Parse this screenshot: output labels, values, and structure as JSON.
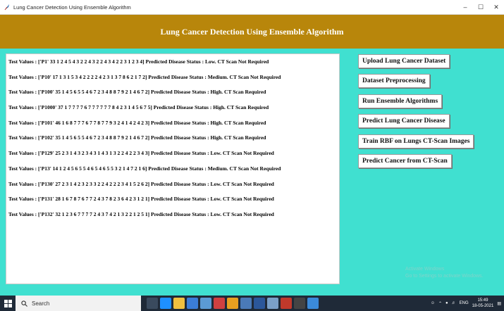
{
  "window": {
    "title": "Lung Cancer Detection Using Ensemble Algorithm",
    "minimize": "–",
    "maximize": "☐",
    "close": "✕"
  },
  "header": {
    "title": "Lung Cancer Detection Using Ensemble Algorithm"
  },
  "output_lines": [
    "Test Values : ['P1' 33 1 2 4 5 4 3 2 2 4 3 2 2 4 3 4 2 2 3 1 2 3 4] Predicted Disease Status : Low. CT Scan Not Required",
    "Test Values : ['P10' 17 1 3 1 5 3 4 2 2 2 2 4 2 3 1 3 7 8 6 2 1 7 2] Predicted Disease Status : Medium. CT Scan Not Required",
    "Test Values : ['P100' 35 1 4 5 6 5 5 4 6 7 2 3 4 8 8 7 9 2 1 4 6 7 2] Predicted Disease Status : High. CT Scan Required",
    "Test Values : ['P1000' 37 1 7 7 7 7 6 7 7 7 7 7 7 8 4 2 3 1 4 5 6 7 5] Predicted Disease Status : High. CT Scan Required",
    "Test Values : ['P101' 46 1 6 8 7 7 7 6 7 7 8 7 7 9 3 2 4 1 4 2 4 2 3] Predicted Disease Status : High. CT Scan Required",
    "Test Values : ['P102' 35 1 4 5 6 5 5 4 6 7 2 3 4 8 8 7 9 2 1 4 6 7 2] Predicted Disease Status : High. CT Scan Required",
    "Test Values : ['P129' 25 2 3 1 4 3 2 3 4 3 1 4 3 1 3 2 2 4 2 2 3 4 3] Predicted Disease Status : Low. CT Scan Not Required",
    "Test Values : ['P13' 14 1 2 4 5 6 5 5 4 6 5 4 6 5 5 3 2 1 4 7 2 1 6] Predicted Disease Status : Medium. CT Scan Not Required",
    "Test Values : ['P130' 27 2 3 1 4 2 3 2 3 3 2 2 4 2 2 2 3 4 1 5 2 6 2] Predicted Disease Status : Low. CT Scan Not Required",
    "Test Values : ['P131' 28 1 6 7 8 7 6 7 7 2 4 3 7 8 2 3 6 4 2 3 1 2 1] Predicted Disease Status : Low. CT Scan Not Required",
    "Test Values : ['P132' 32 1 2 3 6 7 7 7 7 2 4 3 7 4 2 1 3 2 2 1 2 5 1] Predicted Disease Status : Low. CT Scan Not Required"
  ],
  "buttons": [
    "Upload Lung Cancer Dataset",
    "Dataset Preprocessing",
    "Run Ensemble Algorithms",
    "Predict Lung Cancer Disease",
    "Train RBF on Lungs CT-Scan Images",
    "Predict Cancer from CT-Scan"
  ],
  "watermark": {
    "line1": "Activate Windows",
    "line2": "Go to Settings to activate Windows."
  },
  "taskbar": {
    "search_label": "Search",
    "time": "15:49",
    "date": "18-05-2021",
    "language": "ENG"
  },
  "colors": {
    "background": "#40E0D0",
    "header": "#B8860B",
    "taskbar": "#1f2a38"
  }
}
